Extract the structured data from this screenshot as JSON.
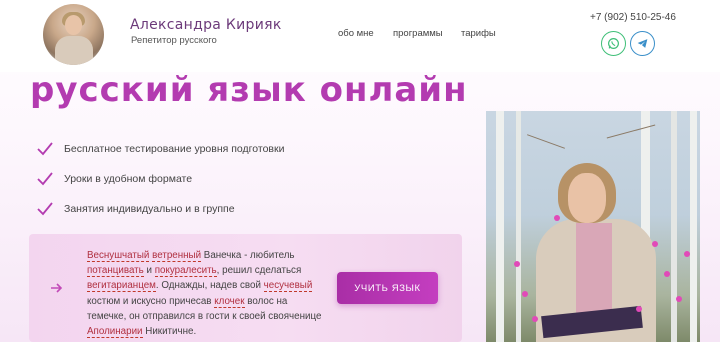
{
  "brand": {
    "name": "Александра Кирияк",
    "subtitle": "Репетитор русского"
  },
  "nav": {
    "items": [
      "обо мне",
      "программы",
      "тарифы"
    ]
  },
  "contact": {
    "phone": "+7 (902) 510-25-46",
    "icons": [
      "whatsapp-icon",
      "telegram-icon"
    ]
  },
  "hero": {
    "headline": "русский язык онлайн",
    "features": [
      "Бесплатное тестирование уровня подготовки",
      "Уроки в удобном формате",
      "Занятия индивидуально и в группе"
    ]
  },
  "card": {
    "quote_segments": [
      {
        "t": "Веснушчатый",
        "u": true
      },
      {
        "t": " ",
        "u": false
      },
      {
        "t": "ветренный",
        "u": true
      },
      {
        "t": " Ванечка - любитель ",
        "u": false
      },
      {
        "t": "потанцивать",
        "u": true
      },
      {
        "t": " и ",
        "u": false
      },
      {
        "t": "покуралесить",
        "u": true
      },
      {
        "t": ", решил сделаться ",
        "u": false
      },
      {
        "t": "вегитарианцем",
        "u": true
      },
      {
        "t": ". Однажды, надев свой ",
        "u": false
      },
      {
        "t": "чесучевый",
        "u": true
      },
      {
        "t": " костюм и искусно причесав ",
        "u": false
      },
      {
        "t": "клочек",
        "u": true
      },
      {
        "t": " волос на темечке, он отправился в гости к своей свояченице ",
        "u": false
      },
      {
        "t": "Аполинарии",
        "u": true
      },
      {
        "t": " Никитичне.",
        "u": false
      }
    ],
    "button_label": "УЧИТЬ ЯЗЫК"
  },
  "colors": {
    "accent": "#b33bb0",
    "brand_text": "#6c3a7a",
    "whatsapp": "#3fbf78",
    "telegram": "#3a8fc9",
    "error_underline": "#c0392b"
  }
}
